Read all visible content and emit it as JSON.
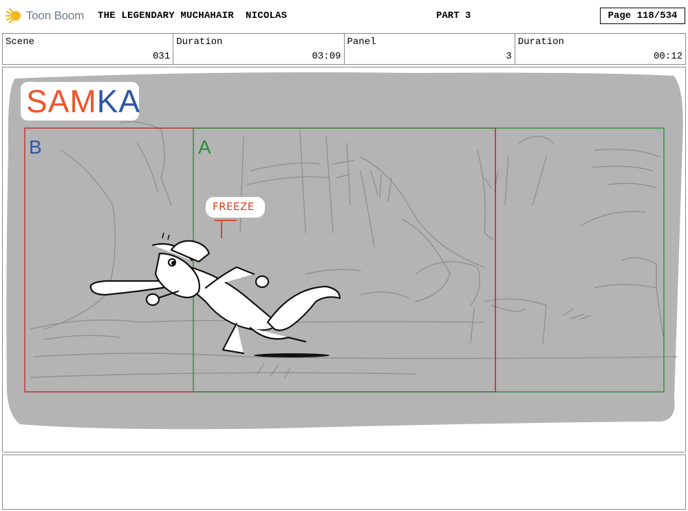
{
  "header": {
    "app_name": "Toon Boom",
    "title": "THE LEGENDARY MUCHAHAIR  NICOLAS",
    "part": "PART 3",
    "page": "Page 118/534"
  },
  "info": {
    "scene_label": "Scene",
    "scene_value": "031",
    "scene_duration_label": "Duration",
    "scene_duration_value": "03:09",
    "panel_label": "Panel",
    "panel_value": "3",
    "panel_duration_label": "Duration",
    "panel_duration_value": "00:12"
  },
  "panel": {
    "logo_text": "SAMKA",
    "field_b": "B",
    "field_a": "A",
    "annotation": "FREEZE",
    "colors": {
      "field_b": "#c0282d",
      "field_a": "#2e8b3a",
      "background": "#b4b4b4",
      "samka_orange": "#f0542a",
      "samka_blue": "#2c56a8"
    }
  },
  "notes": {}
}
